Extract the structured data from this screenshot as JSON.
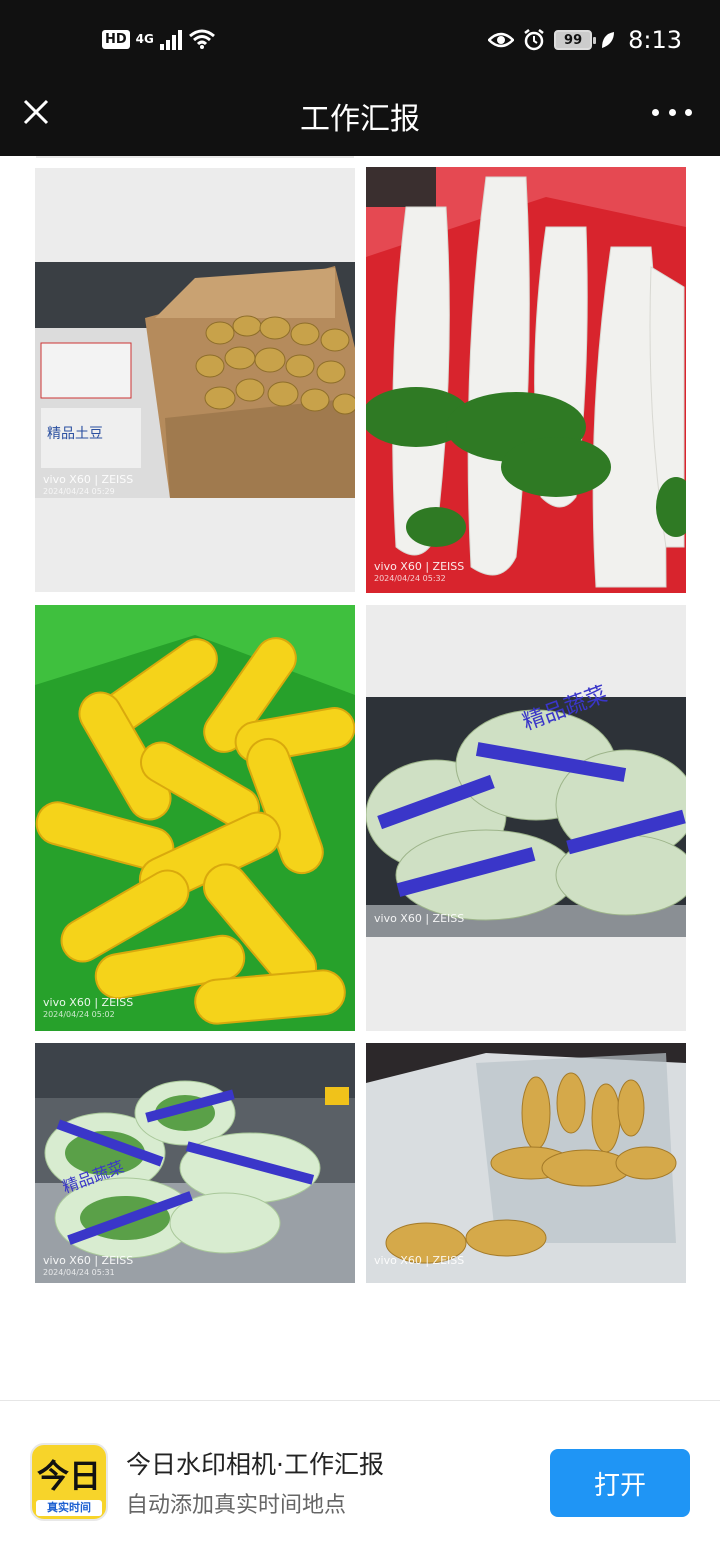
{
  "status_bar": {
    "hd": "HD",
    "network": "4G",
    "battery": "99",
    "time": "8:13"
  },
  "header": {
    "title": "工作汇报",
    "close_icon": "close-icon",
    "more_icon": "more-icon"
  },
  "photos": [
    {
      "brand": "vivo X60 | ZEISS",
      "date": "2024/04/24 05:29",
      "subject": "potatoes",
      "badge_text": "精品土豆"
    },
    {
      "brand": "vivo X60 | ZEISS",
      "date": "2024/04/24 05:32",
      "subject": "white radish"
    },
    {
      "brand": "vivo X60 | ZEISS",
      "date": "2024/04/24 05:02",
      "subject": "corn"
    },
    {
      "brand": "vivo X60 | ZEISS",
      "date": "",
      "subject": "packaged vegetables",
      "badge_text": "精品蔬菜"
    },
    {
      "brand": "vivo X60 | ZEISS",
      "date": "2024/04/24 05:31",
      "subject": "green beans",
      "badge_text": "精品蔬菜"
    },
    {
      "brand": "vivo X60 | ZEISS",
      "date": "",
      "subject": "ginger"
    }
  ],
  "banner": {
    "app_icon_top": "今日",
    "app_icon_bottom": "真实时间",
    "title": "今日水印相机·工作汇报",
    "subtitle": "自动添加真实时间地点",
    "open_label": "打开"
  },
  "colors": {
    "header_bg": "#111111",
    "open_button": "#1f95f5",
    "app_icon_bg": "#f7d42a"
  }
}
